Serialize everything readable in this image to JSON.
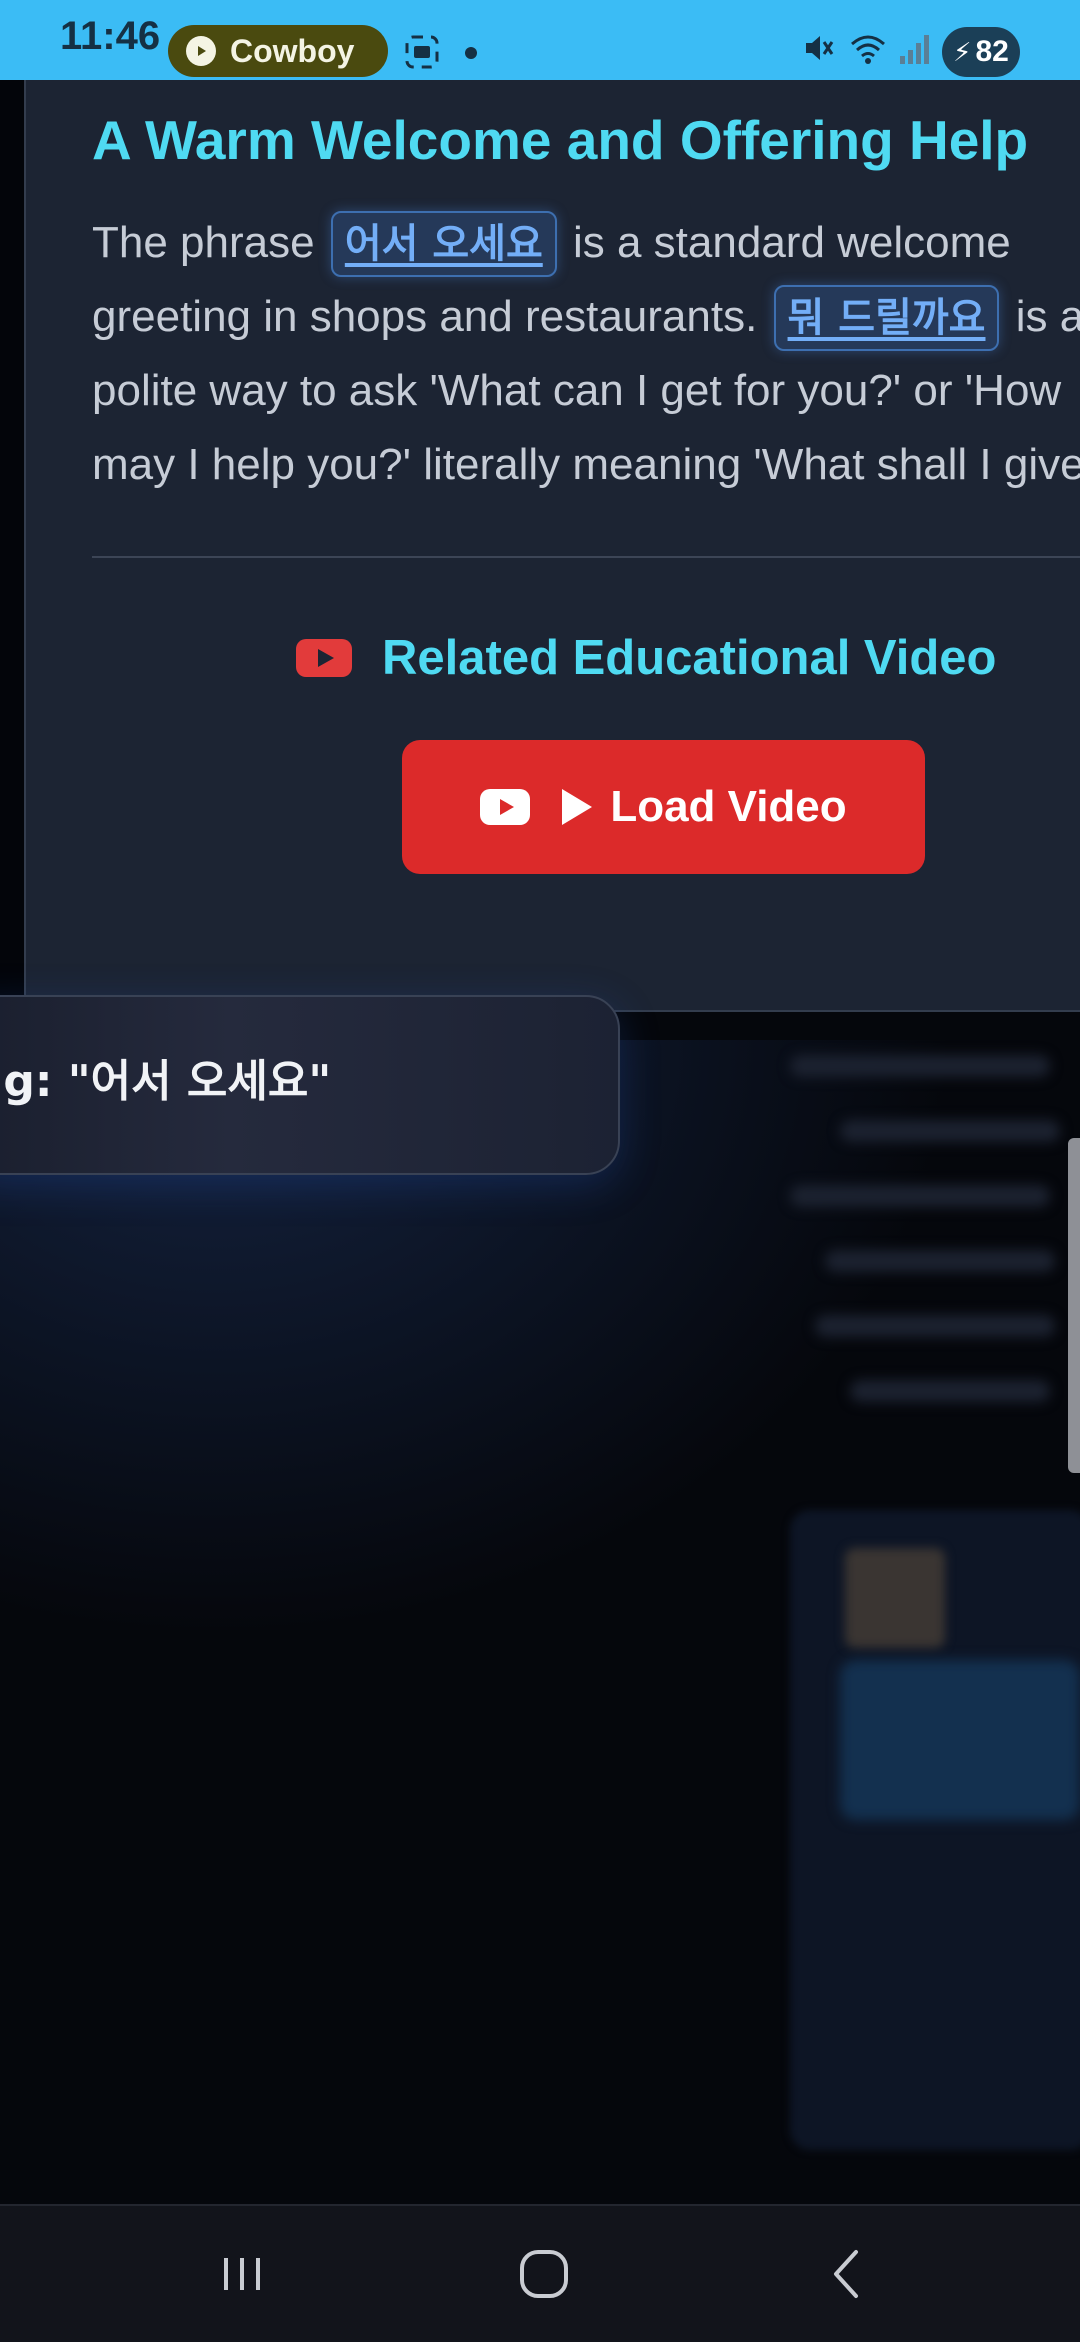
{
  "status_bar": {
    "time": "11:46",
    "media_app": "Cowboy",
    "battery": "82",
    "icons": [
      "screenshot-icon",
      "dot-icon",
      "mute-icon",
      "wifi-icon",
      "signal-icon",
      "battery-icon"
    ]
  },
  "lesson": {
    "title": "A Warm Welcome and Offering Help",
    "paragraph": {
      "line1_prefix": "The phrase",
      "chip1": "어서 오세요",
      "line1_suffix": "is a standard welcome",
      "line2_prefix": "greeting in shops and restaurants.",
      "chip2": "뭐 드릴까요",
      "line2_suffix": "is a",
      "line3": "polite way to ask 'What can I get for you?' or 'How",
      "line4": "may I help you?' literally meaning 'What shall I give?'"
    },
    "video_section": {
      "heading": "Related Educational Video",
      "button_label": "Load Video"
    }
  },
  "bubble": {
    "text": "ng: \"어서 오세요\""
  },
  "colors": {
    "accent_cyan": "#4fdaf2",
    "button_red": "#dc2a2a",
    "chip_blue": "#73aef7",
    "status_bar": "#3bbcf5"
  },
  "nav": {
    "items": [
      "recent-apps-icon",
      "home-icon",
      "back-icon"
    ]
  }
}
